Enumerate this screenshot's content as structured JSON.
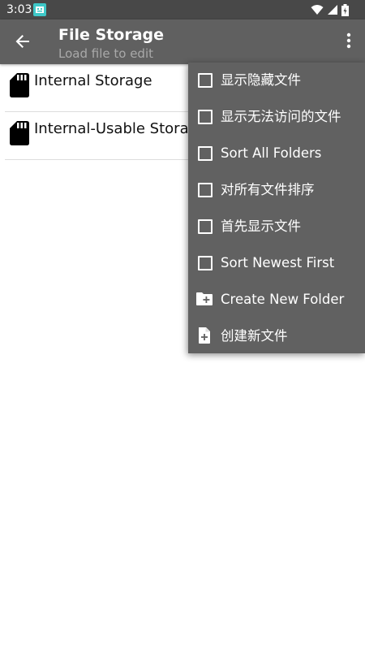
{
  "status_bar": {
    "time": "3:03",
    "app_icon": "app-notification-icon",
    "icons": [
      "wifi-icon",
      "signal-icon",
      "battery-icon"
    ]
  },
  "toolbar": {
    "back_icon": "back-arrow-icon",
    "title": "File Storage",
    "subtitle": "Load file to edit",
    "overflow_icon": "more-vert-icon"
  },
  "storage_list": [
    {
      "icon": "sd-card-icon",
      "label": "Internal Storage"
    },
    {
      "icon": "sd-card-icon",
      "label": "Internal-Usable Storag"
    }
  ],
  "menu": {
    "items": [
      {
        "type": "checkbox",
        "checked": false,
        "label": "显示隐藏文件"
      },
      {
        "type": "checkbox",
        "checked": false,
        "label": "显示无法访问的文件"
      },
      {
        "type": "checkbox",
        "checked": false,
        "label": "Sort All Folders"
      },
      {
        "type": "checkbox",
        "checked": false,
        "label": "对所有文件排序"
      },
      {
        "type": "checkbox",
        "checked": false,
        "label": "首先显示文件"
      },
      {
        "type": "checkbox",
        "checked": false,
        "label": "Sort Newest First"
      },
      {
        "type": "action",
        "icon": "create-folder-icon",
        "label": "Create New Folder"
      },
      {
        "type": "action",
        "icon": "create-file-icon",
        "label": "创建新文件"
      }
    ]
  },
  "colors": {
    "status_bar": "#484848",
    "toolbar": "#606060",
    "menu": "#616161",
    "subtitle": "#a9a9a9"
  }
}
